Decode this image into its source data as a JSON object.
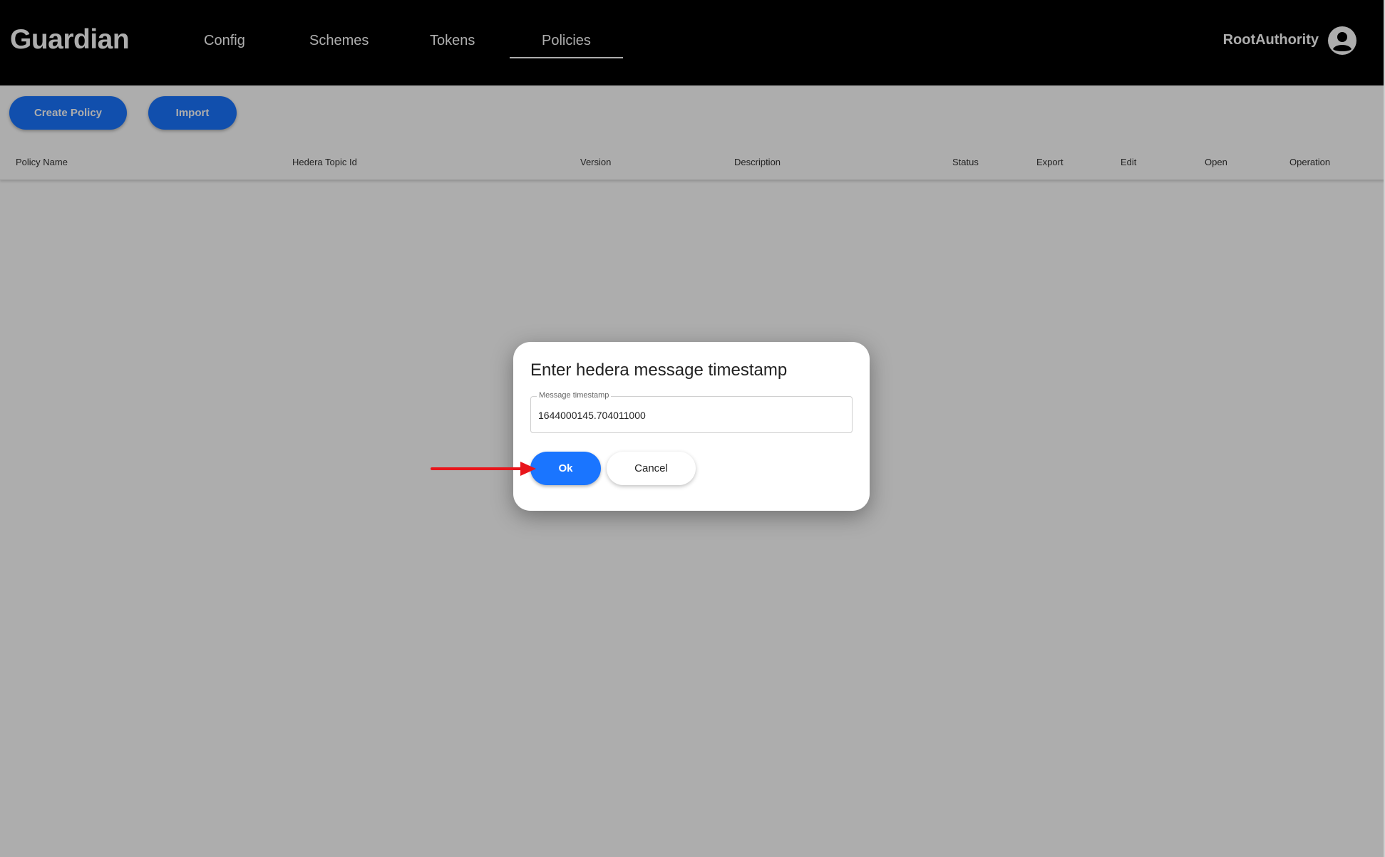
{
  "app": {
    "logo": "Guardian",
    "nav": [
      "Config",
      "Schemes",
      "Tokens",
      "Policies"
    ],
    "active_tab": "Policies",
    "user": "RootAuthority",
    "avatar_icon": "account-circle-icon"
  },
  "toolbar": {
    "create_label": "Create Policy",
    "import_label": "Import"
  },
  "table": {
    "columns": [
      "Policy Name",
      "Hedera Topic Id",
      "Version",
      "Description",
      "Status",
      "Export",
      "Edit",
      "Open",
      "Operation"
    ]
  },
  "dialog": {
    "title": "Enter hedera message timestamp",
    "field_label": "Message timestamp",
    "field_value": "1644000145.704011000",
    "ok_label": "Ok",
    "cancel_label": "Cancel"
  },
  "colors": {
    "header_bg": "#000000",
    "primary": "#1a75ff",
    "overlay": "rgba(0,0,0,0.32)",
    "annotation": "#e8151b"
  }
}
